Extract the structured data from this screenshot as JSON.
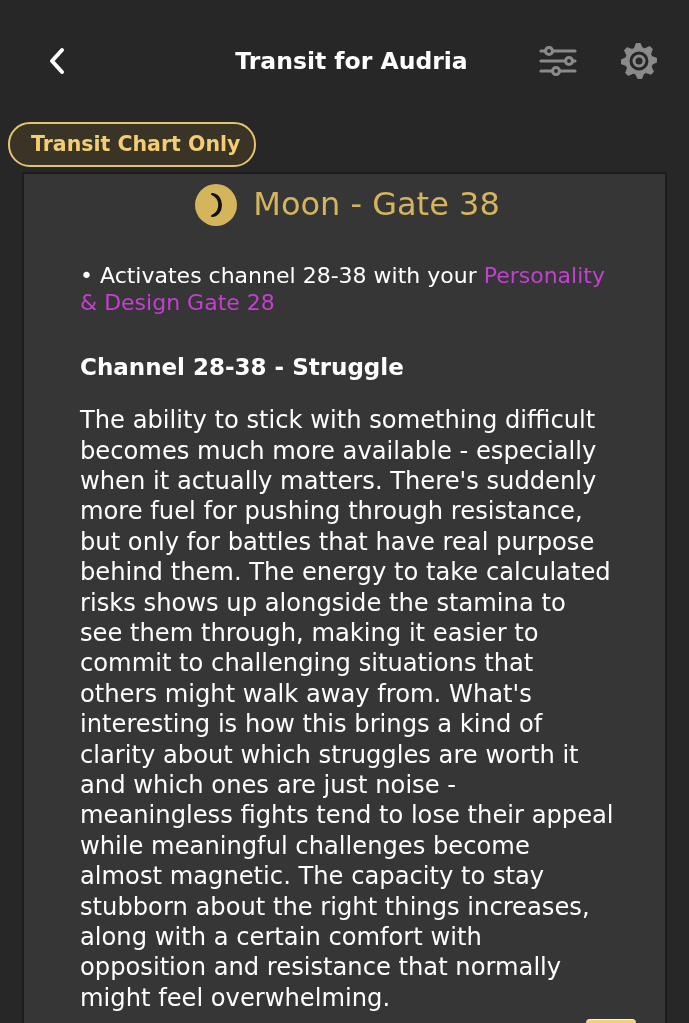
{
  "header": {
    "title": "Transit for Audria"
  },
  "filter_badge": {
    "label": "Transit Chart Only"
  },
  "card": {
    "title": "Moon - Gate 38",
    "activations": [
      {
        "text": "• Activates channel 28-38 with your ",
        "highlight": "Personality & Design Gate 28"
      }
    ],
    "channel": {
      "heading": "Channel 28-38 - Struggle",
      "description": "The ability to stick with something difficult becomes much more available - especially when it actually matters. There's suddenly more fuel for pushing through resistance, but only for battles that have real purpose behind them. The energy to take calculated risks shows up alongside the stamina to see them through, making it easier to commit to challenging situations that others might walk away from. What's interesting is how this brings a kind of clarity about which struggles are worth it and which ones are just noise - meaningless fights tend to lose their appeal while meaningful challenges become almost magnetic. The capacity to stay stubborn about the right things increases, along with a certain comfort with opposition and resistance that normally might feel overwhelming."
    }
  }
}
